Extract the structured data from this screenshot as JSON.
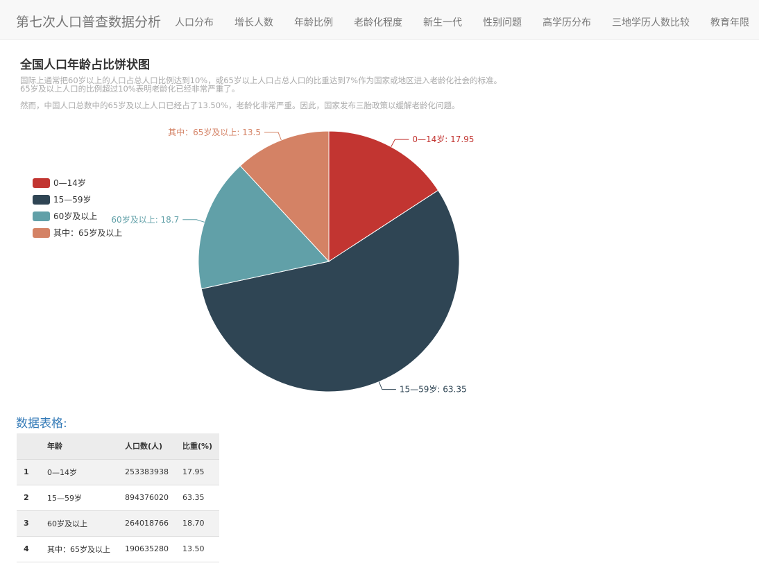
{
  "navbar": {
    "brand": "第七次人口普查数据分析",
    "items": [
      "人口分布",
      "增长人数",
      "年龄比例",
      "老龄化程度",
      "新生一代",
      "性别问题",
      "高学历分布",
      "三地学历人数比较",
      "教育年限"
    ]
  },
  "header": {
    "title": "全国人口年龄占比饼状图",
    "desc_line1": "国际上通常把60岁以上的人口占总人口比例达到10%，或65岁以上人口占总人口的比重达到7%作为国家或地区进入老龄化社会的标准。",
    "desc_line2": "65岁及以上人口的比例超过10%表明老龄化已经非常严重了。",
    "desc_line3": "然而，中国人口总数中的65岁及以上人口已经占了13.50%，老龄化非常严重。因此，国家发布三胎政策以缓解老龄化问题。"
  },
  "colors": {
    "slice_0_14": "#c23531",
    "slice_15_59": "#2f4554",
    "slice_60_plus": "#61a0a8",
    "slice_65_plus": "#d48265",
    "table_title": "#337ab7"
  },
  "chart_data": {
    "type": "pie",
    "title": "全国人口年龄占比饼状图",
    "legend_position": "left",
    "categories": [
      "0—14岁",
      "15—59岁",
      "60岁及以上",
      "其中：65岁及以上"
    ],
    "values": [
      17.95,
      63.35,
      18.7,
      13.5
    ],
    "colors": [
      "#c23531",
      "#2f4554",
      "#61a0a8",
      "#d48265"
    ],
    "labels": [
      "0—14岁: 17.95",
      "15—59岁: 63.35",
      "60岁及以上: 18.7",
      "其中：65岁及以上: 13.5"
    ]
  },
  "table": {
    "title": "数据表格:",
    "headers": [
      "",
      "年龄",
      "人口数(人)",
      "比重(%)"
    ],
    "rows": [
      [
        "1",
        "0—14岁",
        "253383938",
        "17.95"
      ],
      [
        "2",
        "15—59岁",
        "894376020",
        "63.35"
      ],
      [
        "3",
        "60岁及以上",
        "264018766",
        "18.70"
      ],
      [
        "4",
        "其中：65岁及以上",
        "190635280",
        "13.50"
      ]
    ]
  }
}
